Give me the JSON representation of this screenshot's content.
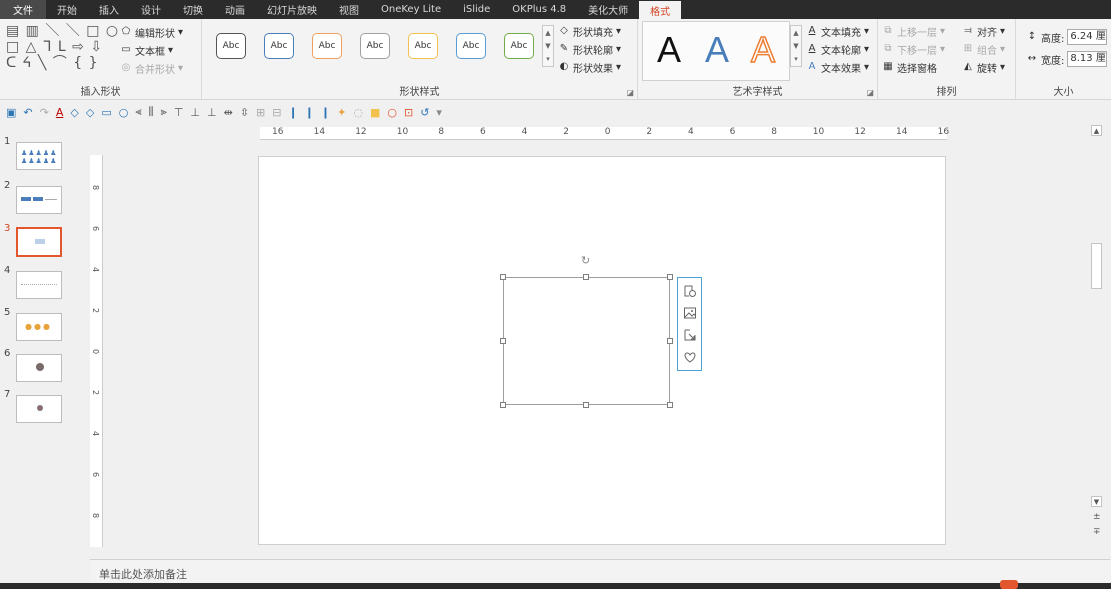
{
  "tabs": [
    "文件",
    "开始",
    "插入",
    "设计",
    "切换",
    "动画",
    "幻灯片放映",
    "视图",
    "OneKey Lite",
    "iSlide",
    "OKPlus 4.8",
    "美化大师",
    "格式"
  ],
  "ribbon": {
    "insert_shapes": {
      "label": "插入形状",
      "edit_shape": "编辑形状",
      "text_box": "文本框",
      "merge_shapes": "合并形状"
    },
    "shape_styles": {
      "label": "形状样式",
      "preset_text": "Abc",
      "fill": "形状填充",
      "outline": "形状轮廓",
      "effects": "形状效果"
    },
    "wordart": {
      "label": "艺术字样式",
      "letter": "A",
      "text_fill": "文本填充",
      "text_outline": "文本轮廓",
      "text_effects": "文本效果"
    },
    "arrange": {
      "label": "排列",
      "bring_forward": "上移一层",
      "send_backward": "下移一层",
      "selection_pane": "选择窗格",
      "align": "对齐",
      "group": "组合",
      "rotate": "旋转"
    },
    "size": {
      "label": "大小",
      "height_label": "高度:",
      "height_value": "6.24 厘米",
      "width_label": "宽度:",
      "width_value": "8.13 厘米"
    }
  },
  "thumbnails": [
    {
      "number": "1",
      "active": false
    },
    {
      "number": "2",
      "active": false
    },
    {
      "number": "3",
      "active": true
    },
    {
      "number": "4",
      "active": false
    },
    {
      "number": "5",
      "active": false
    },
    {
      "number": "6",
      "active": false
    },
    {
      "number": "7",
      "active": false
    }
  ],
  "hruler_labels": [
    "16",
    "14",
    "12",
    "10",
    "8",
    "6",
    "4",
    "2",
    "0",
    "2",
    "4",
    "6",
    "8",
    "10",
    "12",
    "14",
    "16"
  ],
  "vruler_labels": [
    "8",
    "6",
    "4",
    "2",
    "0",
    "2",
    "4",
    "6",
    "8"
  ],
  "notes_placeholder": "单击此处添加备注",
  "quick_tools_icons": [
    "layout-options-icon",
    "picture-icon",
    "resize-icon",
    "heart-icon"
  ],
  "colors": {
    "accent": "#d24726",
    "selection_border": "#4aa3d6",
    "tab_background": "#2b2b2b"
  }
}
